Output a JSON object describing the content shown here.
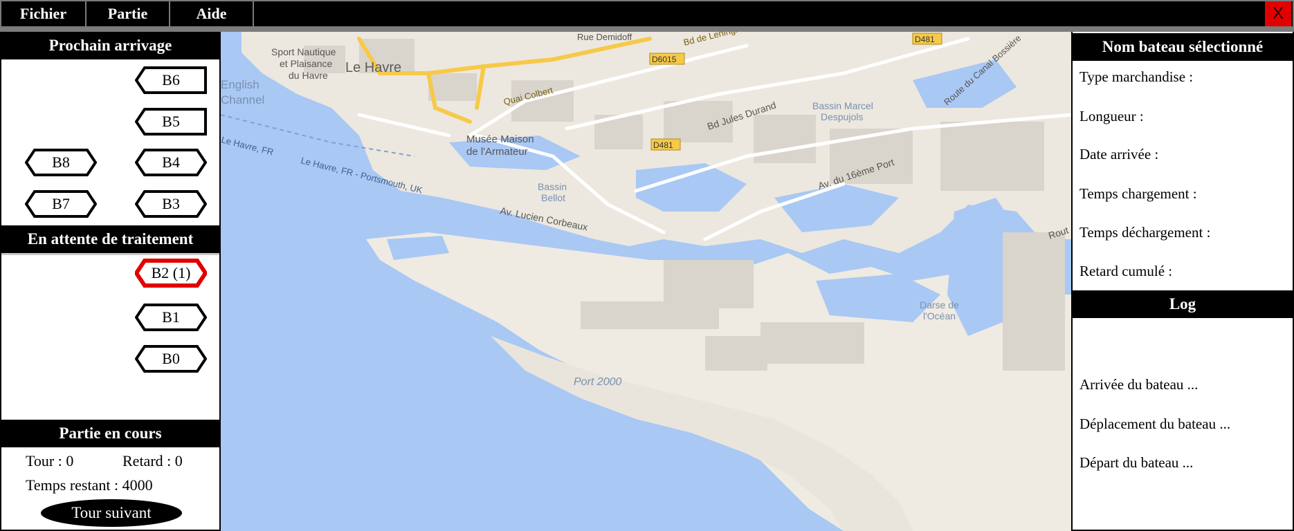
{
  "menu": {
    "fichier": "Fichier",
    "partie": "Partie",
    "aide": "Aide",
    "close": "X"
  },
  "colors": {
    "accent_red": "#e10000",
    "sea": "#a9c8f4",
    "land": "#efebe2",
    "header_bg": "#000000"
  },
  "left": {
    "arrivage_title": "Prochain arrivage",
    "arrivage_boats": [
      "B6",
      "B5",
      "B8",
      "B4",
      "B7",
      "B3"
    ],
    "attente_title": "En attente de traitement",
    "attente_boats": [
      "B2 (1)",
      "B1",
      "B0"
    ],
    "partie_title": "Partie en cours",
    "tour": "Tour : 0",
    "retard": "Retard : 0",
    "temps_restant": "Temps restant : 4000",
    "tour_suivant": "Tour suivant"
  },
  "right": {
    "selected_title": "Nom bateau sélectionné",
    "fields": {
      "type": "Type marchandise :",
      "longueur": "Longueur :",
      "date": "Date arrivée :",
      "chargement": "Temps chargement :",
      "dechargement": "Temps déchargement :",
      "retard": "Retard cumulé :"
    },
    "log_title": "Log",
    "log": [
      "Arrivée du bateau ...",
      "Déplacement du bateau ...",
      "Départ du bateau ..."
    ]
  },
  "map": {
    "labels": {
      "le_havre": "Le Havre",
      "english": "English",
      "channel": "Channel",
      "sport1": "Sport Nautique",
      "sport2": "et Plaisance",
      "sport3": "du Havre",
      "rue_demidoff": "Rue Demidoff",
      "bd_leningrad": "Bd de Leningr",
      "d481a": "D481",
      "d481b": "D481",
      "d6015": "D6015",
      "quai_colbert": "Quai Colbert",
      "musee1": "Musée Maison",
      "musee2": "de l'Armateur",
      "bd_jules": "Bd Jules Durand",
      "bassin_marcel1": "Bassin Marcel",
      "bassin_marcel2": "Despujols",
      "route_canal": "Route du Canal Bossière",
      "ferry1": "Le Havre, FR",
      "ferry2": "Le Havre, FR - Portsmouth, UK",
      "bassin_bellot1": "Bassin",
      "bassin_bellot2": "Bellot",
      "av_lucien": "Av. Lucien Corbeaux",
      "av_16": "Av. du 16ème Port",
      "rout": "Rout",
      "darse1": "Darse de",
      "darse2": "l'Océan",
      "port2000": "Port 2000"
    }
  }
}
